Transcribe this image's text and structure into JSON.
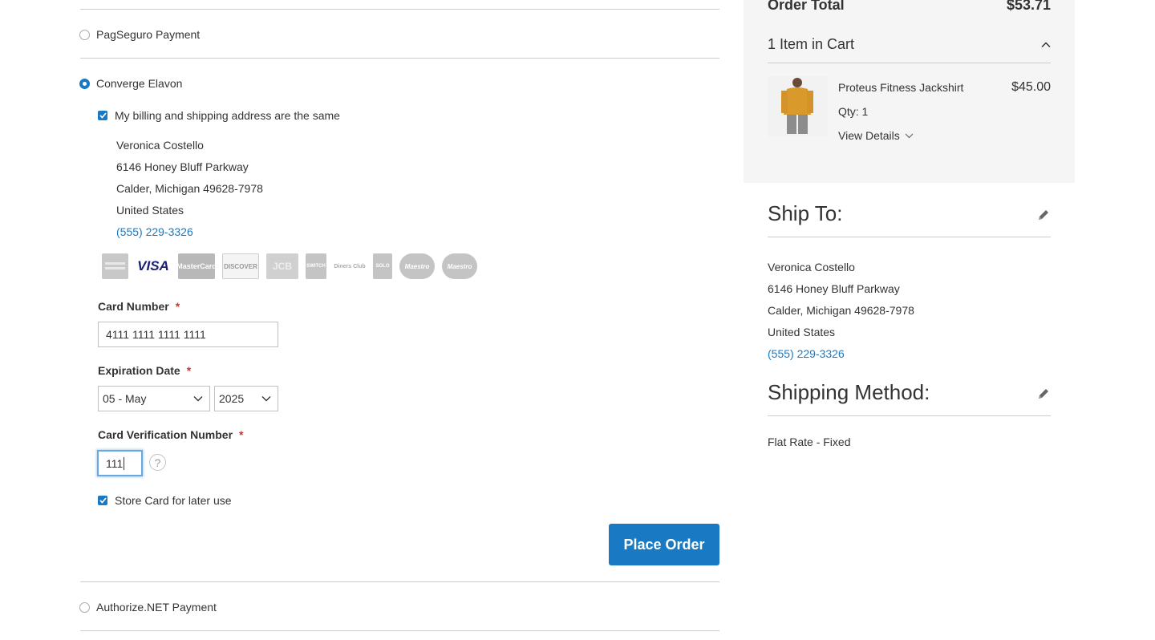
{
  "payment": {
    "methods": [
      {
        "label": "PagSeguro Payment",
        "selected": false
      },
      {
        "label": "Converge Elavon",
        "selected": true
      },
      {
        "label": "Authorize.NET Payment",
        "selected": false
      }
    ],
    "same_address_label": "My billing and shipping address are the same",
    "billing_address": {
      "name": "Veronica Costello",
      "street": "6146 Honey Bluff Parkway",
      "city_line": "Calder, Michigan 49628-7978",
      "country": "United States",
      "phone": "(555) 229-3326"
    },
    "card_types": [
      {
        "icon": "amex-card-icon",
        "text": ""
      },
      {
        "icon": "visa-card-icon",
        "text": "VISA"
      },
      {
        "icon": "mastercard-card-icon",
        "text": "MasterCard"
      },
      {
        "icon": "discover-card-icon",
        "text": "DISCOVER"
      },
      {
        "icon": "jcb-card-icon",
        "text": "JCB"
      },
      {
        "icon": "switch-card-icon",
        "text": "SWITCH"
      },
      {
        "icon": "diners-club-card-icon",
        "text": "Diners Club"
      },
      {
        "icon": "solo-card-icon",
        "text": "SOLO"
      },
      {
        "icon": "maestro-card-icon",
        "text": "Maestro"
      },
      {
        "icon": "maestro-card-icon",
        "text": "Maestro"
      }
    ],
    "card_number_label": "Card Number",
    "card_number_value": "4111 1111 1111 1111",
    "expiration_label": "Expiration Date",
    "exp_month": "05 - May",
    "exp_year": "2025",
    "cvv_label": "Card Verification Number",
    "cvv_value": "111",
    "help_glyph": "?",
    "required_mark": "*",
    "store_card_label": "Store Card for later use",
    "place_order_label": "Place Order"
  },
  "summary": {
    "order_total_label": "Order Total",
    "order_total_value": "$53.71",
    "items_in_cart": "1 Item in Cart",
    "product": {
      "name": "Proteus Fitness Jackshirt",
      "price": "$45.00",
      "qty": "Qty: 1",
      "view_details": "View Details"
    }
  },
  "ship_to": {
    "title": "Ship To:",
    "name": "Veronica Costello",
    "street": "6146 Honey Bluff Parkway",
    "city_line": "Calder, Michigan 49628-7978",
    "country": "United States",
    "phone": "(555) 229-3326"
  },
  "shipping_method": {
    "title": "Shipping Method:",
    "value": "Flat Rate - Fixed"
  },
  "colors": {
    "accent": "#1979c3",
    "required": "#e02b27",
    "summary_bg": "#f5f5f5"
  }
}
